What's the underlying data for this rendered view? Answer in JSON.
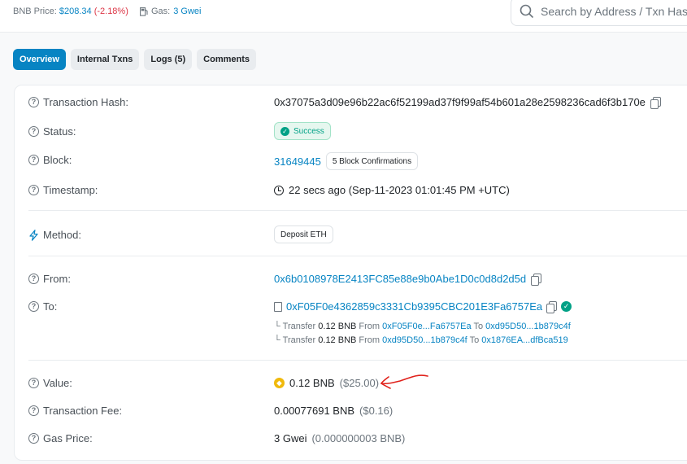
{
  "header": {
    "price_label": "BNB Price:",
    "price_value": "$208.34",
    "price_change": "(-2.18%)",
    "gas_label": "Gas:",
    "gas_value": "3 Gwei",
    "search_placeholder": "Search by Address / Txn Hash"
  },
  "tabs": [
    {
      "label": "Overview",
      "active": true
    },
    {
      "label": "Internal Txns",
      "active": false
    },
    {
      "label": "Logs (5)",
      "active": false
    },
    {
      "label": "Comments",
      "active": false
    }
  ],
  "details": {
    "tx_hash_label": "Transaction Hash:",
    "tx_hash": "0x37075a3d09e96b22ac6f52199ad37f9f99af54b601a28e2598236cad6f3b170e",
    "status_label": "Status:",
    "status": "Success",
    "block_label": "Block:",
    "block": "31649445",
    "confirmations": "5 Block Confirmations",
    "timestamp_label": "Timestamp:",
    "timestamp": "22 secs ago (Sep-11-2023 01:01:45 PM +UTC)",
    "method_label": "Method:",
    "method": "Deposit ETH",
    "from_label": "From:",
    "from": "0x6b0108978E2413FC85e88e9b0Abe1D0c0d8d2d5d",
    "to_label": "To:",
    "to": "0xF05F0e4362859c3331Cb9395CBC201E3Fa6757Ea",
    "transfers": [
      {
        "prefix": "Transfer",
        "amount": "0.12 BNB",
        "from_word": "From",
        "from": "0xF05F0e...Fa6757Ea",
        "to_word": "To",
        "to": "0xd95D50...1b879c4f"
      },
      {
        "prefix": "Transfer",
        "amount": "0.12 BNB",
        "from_word": "From",
        "from": "0xd95D50...1b879c4f",
        "to_word": "To",
        "to": "0x1876EA...dfBca519"
      }
    ],
    "value_label": "Value:",
    "value": "0.12 BNB",
    "value_usd": "($25.00)",
    "fee_label": "Transaction Fee:",
    "fee": "0.00077691 BNB",
    "fee_usd": "($0.16)",
    "gas_price_label": "Gas Price:",
    "gas_price": "3 Gwei",
    "gas_price_bnb": "(0.000000003 BNB)"
  },
  "colors": {
    "accent": "#0784c3",
    "success": "#00a186",
    "negative": "#dc3545",
    "annotation": "#e0201a",
    "bnb": "#f0b90b"
  },
  "icons": [
    "gas-pump-icon",
    "search-icon",
    "question-circle-icon",
    "copy-icon",
    "check-circle-icon",
    "clock-icon",
    "lightning-icon",
    "contract-document-icon",
    "verified-check-icon",
    "bnb-coin-icon",
    "corner-arrow-icon"
  ]
}
